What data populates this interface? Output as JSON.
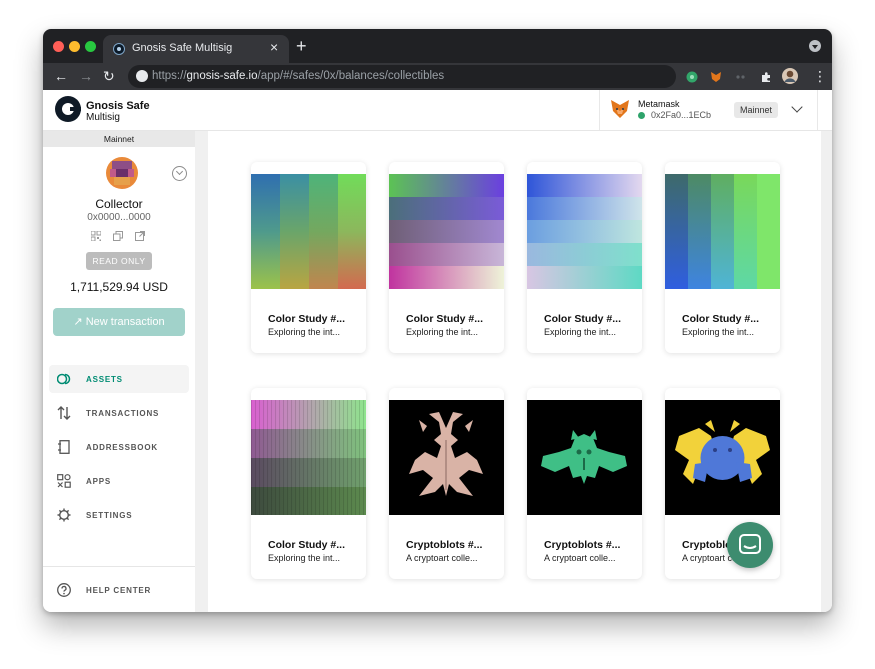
{
  "browser": {
    "tab_title": "Gnosis Safe Multisig",
    "tab_close": "×",
    "new_tab": "+",
    "url_prefix": "https://",
    "url_host": "gnosis-safe.io",
    "url_path": "/app/#/safes/0x/balances/collectibles",
    "back": "←",
    "forward": "→",
    "reload": "↻",
    "menu": "⋮"
  },
  "header": {
    "logo_line1": "Gnosis Safe",
    "logo_line2": "Multisig",
    "wallet_name": "Metamask",
    "wallet_address": "0x2Fa0...1ECb",
    "network": "Mainnet"
  },
  "sidebar": {
    "network": "Mainnet",
    "safe_name": "Collector",
    "safe_address": "0x0000...0000",
    "read_only": "READ ONLY",
    "balance": "1,711,529.94 USD",
    "new_transaction": "↗ New transaction",
    "items": [
      {
        "label": "ASSETS",
        "icon": "assets-icon",
        "active": true
      },
      {
        "label": "TRANSACTIONS",
        "icon": "transactions-icon",
        "active": false
      },
      {
        "label": "ADDRESSBOOK",
        "icon": "addressbook-icon",
        "active": false
      },
      {
        "label": "APPS",
        "icon": "apps-icon",
        "active": false
      },
      {
        "label": "SETTINGS",
        "icon": "settings-icon",
        "active": false
      }
    ],
    "help": "HELP CENTER"
  },
  "collectibles": [
    {
      "title": "Color Study #...",
      "description": "Exploring the int...",
      "art": "color-study-1"
    },
    {
      "title": "Color Study #...",
      "description": "Exploring the int...",
      "art": "color-study-2"
    },
    {
      "title": "Color Study #...",
      "description": "Exploring the int...",
      "art": "color-study-3"
    },
    {
      "title": "Color Study #...",
      "description": "Exploring the int...",
      "art": "color-study-4"
    },
    {
      "title": "Color Study #...",
      "description": "Exploring the int...",
      "art": "color-study-5"
    },
    {
      "title": "Cryptoblots #...",
      "description": "A cryptoart colle...",
      "art": "cryptoblot-1"
    },
    {
      "title": "Cryptoblots #...",
      "description": "A cryptoart colle...",
      "art": "cryptoblot-2"
    },
    {
      "title": "Cryptoblots #...",
      "description": "A cryptoart colle...",
      "art": "cryptoblot-3"
    }
  ],
  "colors": {
    "accent": "#008c73",
    "new_tx_button": "#a1d2ca",
    "chat_button": "#3d8c6f"
  }
}
